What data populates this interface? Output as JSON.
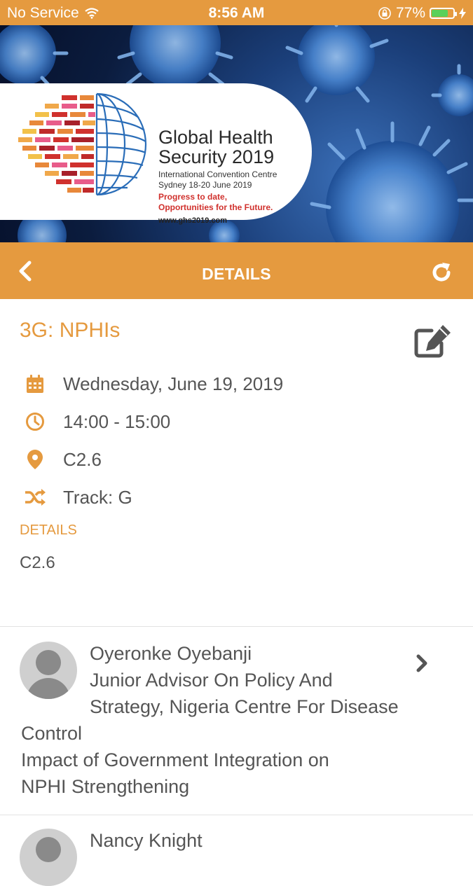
{
  "status_bar": {
    "carrier": "No Service",
    "time": "8:56 AM",
    "battery_percent": "77%",
    "battery_level": 0.77
  },
  "banner": {
    "title_line1": "Global Health",
    "title_line2": "Security 2019",
    "venue": "International Convention Centre",
    "location_dates": "Sydney 18-20 June 2019",
    "tagline_line1": "Progress to date,",
    "tagline_line2": "Opportunities for the Future.",
    "url": "www.ghs2019.com"
  },
  "nav": {
    "title": "DETAILS",
    "back_icon": "chevron-left-icon",
    "refresh_icon": "refresh-icon"
  },
  "session": {
    "title": "3G: NPHIs",
    "date": "Wednesday, June 19, 2019",
    "time": "14:00 - 15:00",
    "location": "C2.6",
    "track": "Track: G",
    "details_label": "DETAILS",
    "details_value": "C2.6"
  },
  "speakers": [
    {
      "name": "Oyeronke Oyebanji",
      "role_line1": "Junior Advisor On Policy And",
      "role_line2": "Strategy, Nigeria Centre For Disease",
      "role_line3": "Control",
      "talk_line1": "Impact of Government Integration on",
      "talk_line2": "NPHI Strengthening"
    },
    {
      "name": "Nancy Knight"
    }
  ],
  "colors": {
    "accent": "#e59a3f",
    "text": "#555555",
    "battery_green": "#5ad05a"
  }
}
